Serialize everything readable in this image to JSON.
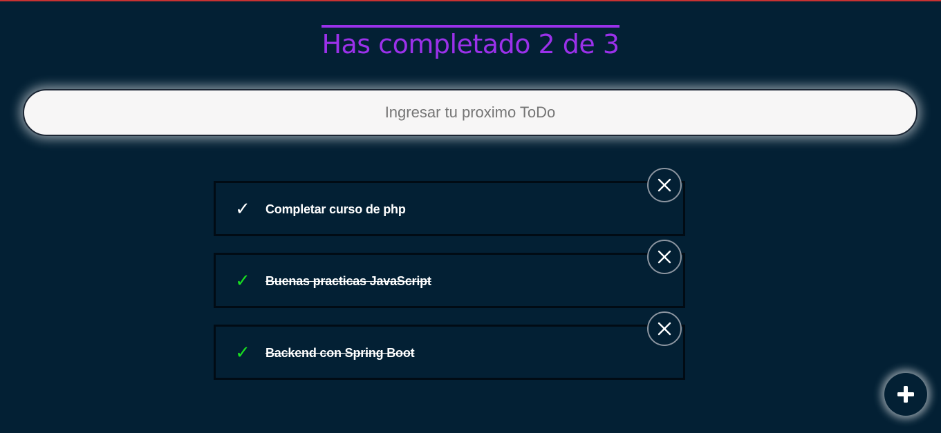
{
  "header": {
    "title": "Has completado 2 de 3"
  },
  "search": {
    "placeholder": "Ingresar tu proximo ToDo",
    "value": ""
  },
  "todos": [
    {
      "text": "Completar curso de php",
      "completed": false,
      "check_icon": "check-icon"
    },
    {
      "text": "Buenas practicas JavaScript",
      "completed": true,
      "check_icon": "check-icon"
    },
    {
      "text": "Backend con Spring Boot",
      "completed": true,
      "check_icon": "check-icon"
    }
  ],
  "icons": {
    "check": "✓",
    "delete": "close-icon",
    "add": "plus-icon"
  },
  "colors": {
    "background": "#032034",
    "accent": "#9b31ea",
    "completed_check": "#18e020",
    "pending_check": "#ffffff"
  }
}
